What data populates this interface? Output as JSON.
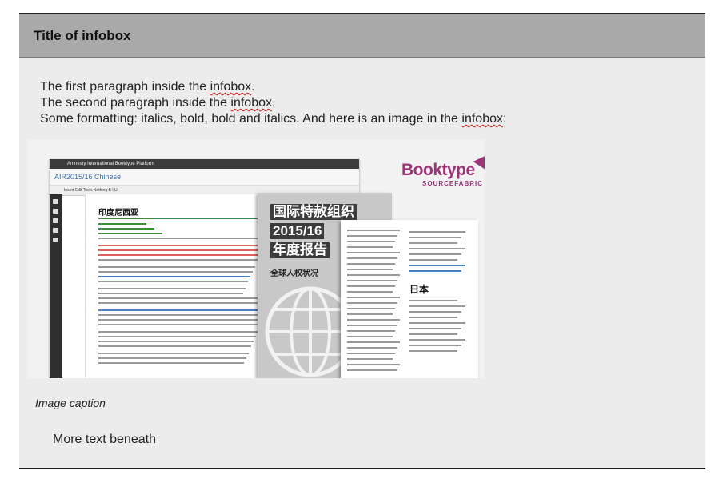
{
  "infobox": {
    "title": "Title of infobox",
    "paragraphs": {
      "p1_before": "The first paragraph inside the ",
      "p1_word": "infobox",
      "p1_after": ".",
      "p2_before": "The second paragraph inside the ",
      "p2_word": "infobox",
      "p2_after": ".",
      "p3_before": "Some formatting: italics, bold, bold and italics. And here is an image in the ",
      "p3_word": "infobox",
      "p3_after": ":"
    },
    "image": {
      "app_bar": "Amnesty International Booktype Platform",
      "book_title": "AIR2015/16 Chinese",
      "toolbar": "Insert   Edit   Tools      Nothing     B  I  U",
      "doc_heading": "印度尼西亚",
      "cover_lines": [
        "国际特赦组织",
        "2015/16",
        "年度报告"
      ],
      "cover_subtitle": "全球人权状况",
      "page_heading": "日本",
      "logo_name": "Booktype",
      "logo_sub": "SOURCEFABRIC"
    },
    "caption": "Image caption",
    "more_text": "More text beneath"
  }
}
